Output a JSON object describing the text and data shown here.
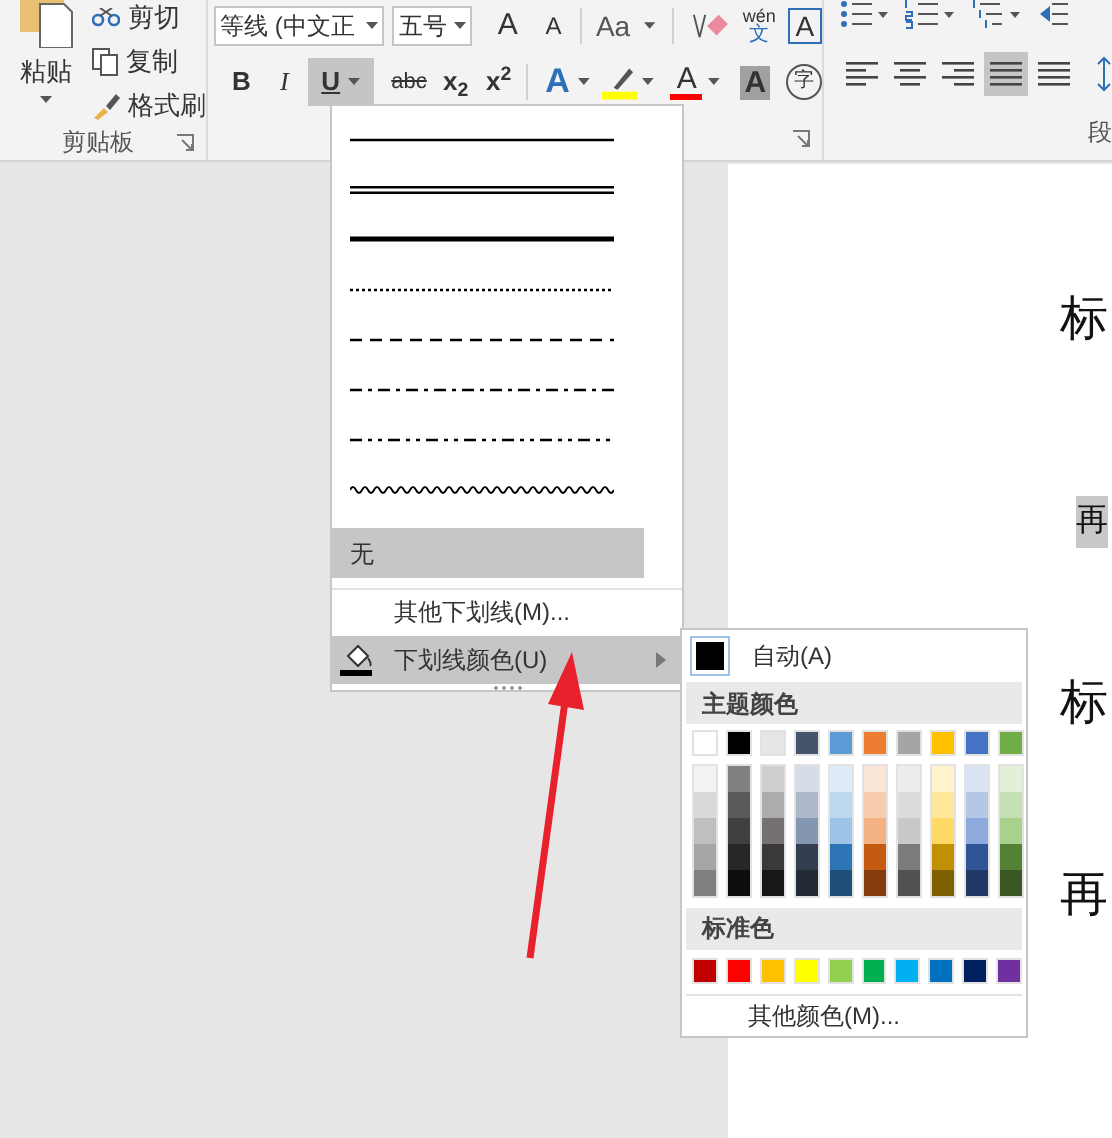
{
  "ribbon": {
    "clipboard": {
      "paste": "粘贴",
      "cut": "剪切",
      "copy": "复制",
      "format_painter": "格式刷",
      "group_label": "剪贴板"
    },
    "font": {
      "font_name": "等线 (中文正",
      "font_size": "五号",
      "grow": "A",
      "shrink": "A",
      "change_case": "Aa",
      "phonetic_top": "wén",
      "phonetic_bottom": "文",
      "char_border": "A",
      "bold": "B",
      "italic": "I",
      "underline": {
        "label": "U",
        "selected": true
      },
      "strikethrough": "abc",
      "subscript": "x$_{2}$",
      "superscript": "x$^{2}$",
      "text_effects": "A",
      "font_color": "A",
      "char_shading": "A",
      "enclose": "字"
    },
    "paragraph": {
      "group_label": "段",
      "alignments": [
        {
          "kind": "left",
          "selected": false
        },
        {
          "kind": "center",
          "selected": false
        },
        {
          "kind": "right",
          "selected": false
        },
        {
          "kind": "justify",
          "selected": true
        },
        {
          "kind": "distributed",
          "selected": false
        }
      ]
    }
  },
  "underline_menu": {
    "styles": [
      {
        "kind": "single"
      },
      {
        "kind": "double"
      },
      {
        "kind": "thick"
      },
      {
        "kind": "dotted"
      },
      {
        "kind": "dashed"
      },
      {
        "kind": "dash-dot"
      },
      {
        "kind": "dash-dot-dot"
      },
      {
        "kind": "wavy"
      }
    ],
    "none": {
      "label": "无",
      "selected": true
    },
    "more": "其他下划线(M)...",
    "color_item": {
      "label": "下划线颜色(U)",
      "selected": true
    }
  },
  "color_menu": {
    "automatic": "自动(A)",
    "theme_heading": "主题颜色",
    "theme_colors": [
      {
        "color": "#ffffff",
        "shades": [
          {
            "color": "#f2f2f2"
          },
          {
            "color": "#d9d9d9"
          },
          {
            "color": "#bfbfbf"
          },
          {
            "color": "#a6a6a6"
          },
          {
            "color": "#808080"
          }
        ]
      },
      {
        "color": "#000000",
        "shades": [
          {
            "color": "#808080"
          },
          {
            "color": "#595959"
          },
          {
            "color": "#404040"
          },
          {
            "color": "#262626"
          },
          {
            "color": "#0d0d0d"
          }
        ]
      },
      {
        "color": "#e7e6e6",
        "shades": [
          {
            "color": "#d0cece"
          },
          {
            "color": "#aeabab"
          },
          {
            "color": "#767171"
          },
          {
            "color": "#3b3838"
          },
          {
            "color": "#181717"
          }
        ]
      },
      {
        "color": "#44546a",
        "shades": [
          {
            "color": "#d6dce5"
          },
          {
            "color": "#adb9ca"
          },
          {
            "color": "#8497b0"
          },
          {
            "color": "#333f50"
          },
          {
            "color": "#222a35"
          }
        ]
      },
      {
        "color": "#5b9bd5",
        "shades": [
          {
            "color": "#deebf7"
          },
          {
            "color": "#bdd7ee"
          },
          {
            "color": "#9dc3e6"
          },
          {
            "color": "#2e75b6"
          },
          {
            "color": "#1f4e79"
          }
        ]
      },
      {
        "color": "#ed7d31",
        "shades": [
          {
            "color": "#fbe5d6"
          },
          {
            "color": "#f8cbad"
          },
          {
            "color": "#f4b183"
          },
          {
            "color": "#c55a11"
          },
          {
            "color": "#843c0c"
          }
        ]
      },
      {
        "color": "#a5a5a5",
        "shades": [
          {
            "color": "#ededed"
          },
          {
            "color": "#dbdbdb"
          },
          {
            "color": "#c9c9c9"
          },
          {
            "color": "#7b7b7b"
          },
          {
            "color": "#525252"
          }
        ]
      },
      {
        "color": "#ffc000",
        "shades": [
          {
            "color": "#fff2cc"
          },
          {
            "color": "#ffe699"
          },
          {
            "color": "#ffd966"
          },
          {
            "color": "#bf9000"
          },
          {
            "color": "#7f6000"
          }
        ]
      },
      {
        "color": "#4472c4",
        "shades": [
          {
            "color": "#dae3f3"
          },
          {
            "color": "#b4c7e7"
          },
          {
            "color": "#8faadc"
          },
          {
            "color": "#2f5597"
          },
          {
            "color": "#203864"
          }
        ]
      },
      {
        "color": "#70ad47",
        "shades": [
          {
            "color": "#e2f0d9"
          },
          {
            "color": "#c5e0b4"
          },
          {
            "color": "#a9d18e"
          },
          {
            "color": "#548235"
          },
          {
            "color": "#385723"
          }
        ]
      }
    ],
    "standard_heading": "标准色",
    "standard_colors": [
      {
        "color": "#c00000"
      },
      {
        "color": "#ff0000"
      },
      {
        "color": "#ffc000"
      },
      {
        "color": "#ffff00"
      },
      {
        "color": "#92d050"
      },
      {
        "color": "#00b050"
      },
      {
        "color": "#00b0f0"
      },
      {
        "color": "#0070c0"
      },
      {
        "color": "#002060"
      },
      {
        "color": "#7030a0"
      }
    ],
    "more": "其他颜色(M)..."
  },
  "document": {
    "lines": [
      {
        "text": "标",
        "highlighted": false
      },
      {
        "text": "再",
        "highlighted": true
      },
      {
        "text": "标",
        "highlighted": false
      },
      {
        "text": "再",
        "highlighted": false
      }
    ]
  }
}
